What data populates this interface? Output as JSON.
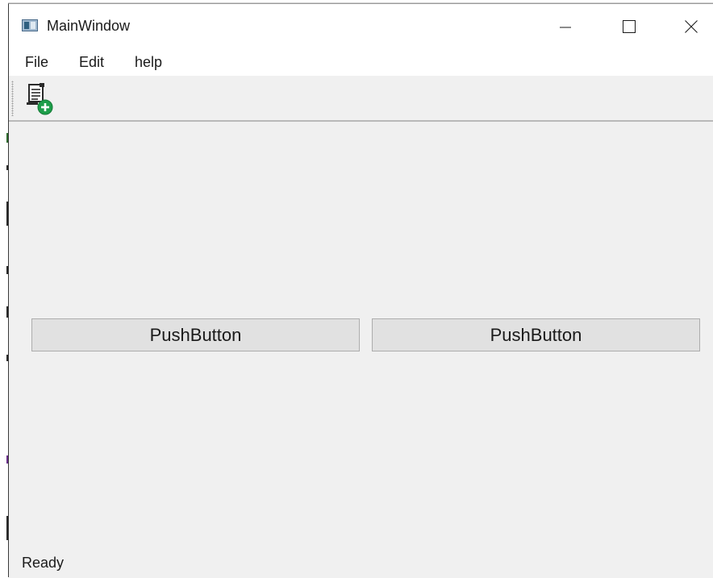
{
  "window": {
    "title": "MainWindow",
    "controls": {
      "minimize": "minimize-icon",
      "maximize": "maximize-icon",
      "close": "close-icon"
    }
  },
  "menubar": {
    "items": [
      {
        "label": "File"
      },
      {
        "label": "Edit"
      },
      {
        "label": "help"
      }
    ]
  },
  "toolbar": {
    "actions": [
      {
        "icon": "document-add-icon"
      }
    ]
  },
  "central": {
    "buttons": [
      {
        "label": "PushButton"
      },
      {
        "label": "PushButton"
      }
    ]
  },
  "statusbar": {
    "message": "Ready"
  },
  "colors": {
    "window_bg": "#f0f0f0",
    "titlebar_bg": "#ffffff",
    "button_bg": "#e1e1e1",
    "button_border": "#adadad",
    "icon_accent": "#1e9e4a"
  }
}
